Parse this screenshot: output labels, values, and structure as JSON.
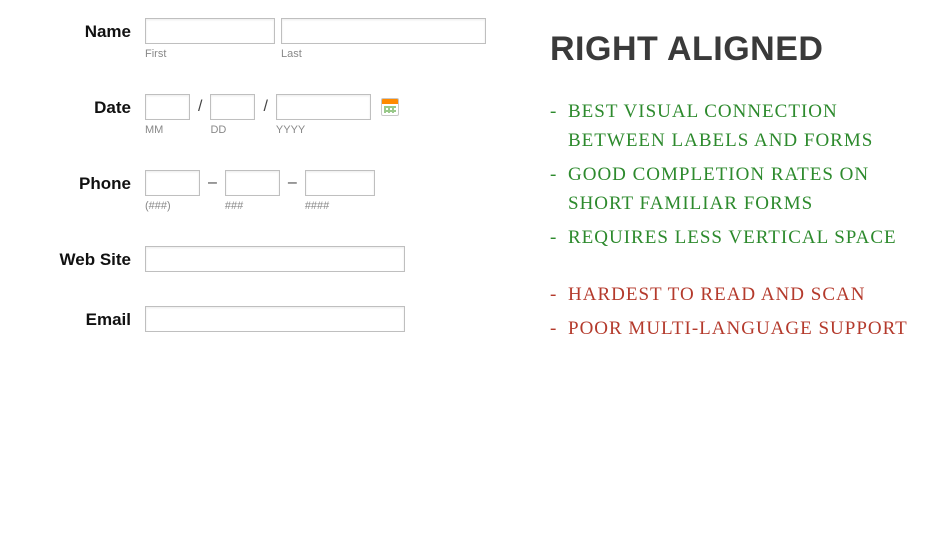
{
  "form": {
    "name": {
      "label": "Name",
      "first_sub": "First",
      "last_sub": "Last"
    },
    "date": {
      "label": "Date",
      "mm_sub": "MM",
      "dd_sub": "DD",
      "yyyy_sub": "YYYY",
      "sep": "/"
    },
    "phone": {
      "label": "Phone",
      "area_sub": "(###)",
      "prefix_sub": "###",
      "line_sub": "####",
      "sep": "–"
    },
    "website": {
      "label": "Web Site"
    },
    "email": {
      "label": "Email"
    }
  },
  "notes": {
    "headline": "RIGHT ALIGNED",
    "pros": [
      "Best visual connection between labels and forms",
      "Good completion rates on short familiar forms",
      "Requires less vertical space"
    ],
    "cons": [
      "Hardest to read and scan",
      "Poor multi-language support"
    ]
  }
}
